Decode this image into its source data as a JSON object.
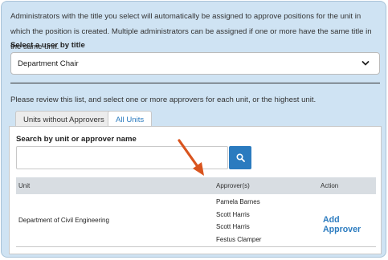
{
  "intro_text": "Administrators with the title you select will automatically be assigned to approve positions for the unit in which the position is created. Multiple administrators can be assigned if one or more have the same title in the same unit.",
  "select": {
    "label": "Select a user by title",
    "value": "Department Chair",
    "icon": "chevron-down-icon"
  },
  "review_text": "Please review this list, and select one or more approvers for each unit, or the highest unit.",
  "tabs": [
    {
      "label": "Units without Approvers",
      "active": false
    },
    {
      "label": "All Units",
      "active": true
    }
  ],
  "search": {
    "label": "Search by unit or approver name",
    "value": "",
    "icon": "search-icon"
  },
  "table": {
    "columns": [
      "Unit",
      "Approver(s)",
      "Action"
    ],
    "rows": [
      {
        "unit": "Department of Civil Engineering",
        "approvers": [
          "Pamela Barnes",
          "Scott Harris",
          "Scott Harris",
          "Festus Clamper"
        ],
        "action": "Add Approver"
      }
    ]
  },
  "colors": {
    "panel_bg": "#cfe3f3",
    "accent": "#2b7bbf",
    "header_bg": "#d8dde2",
    "annotation_arrow": "#d9541e"
  }
}
